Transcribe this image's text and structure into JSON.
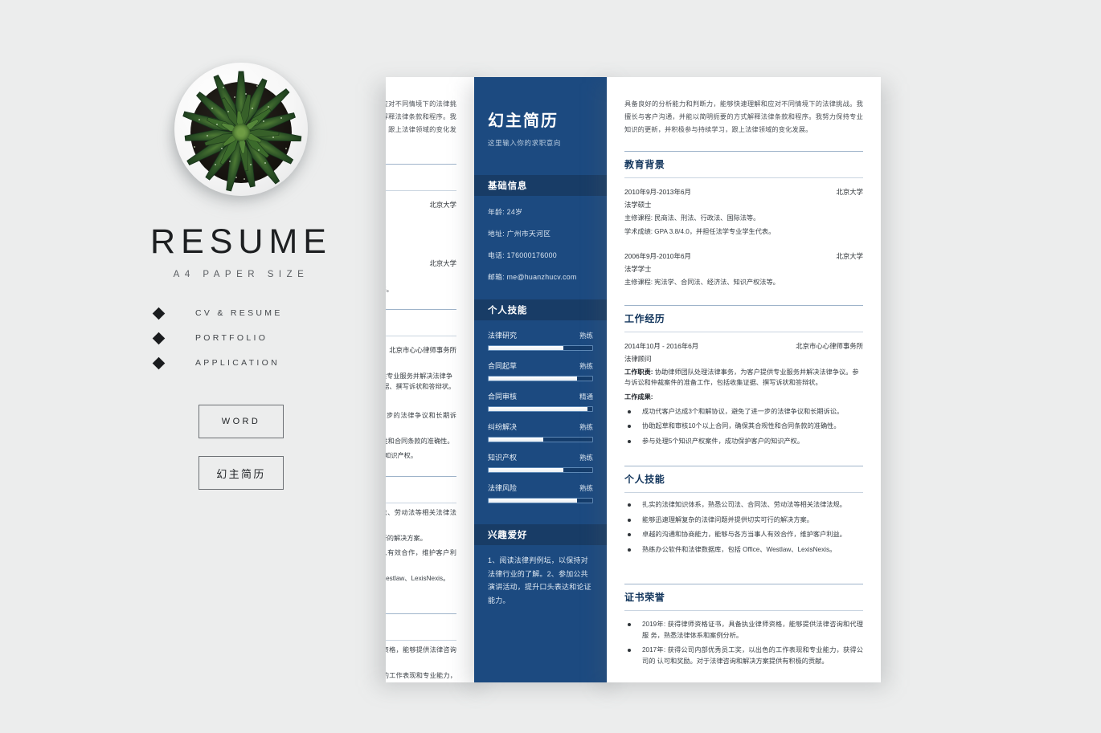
{
  "brand": {
    "title": "RESUME",
    "subtitle": "A4 PAPER SIZE",
    "bullets": [
      {
        "label": "CV & RESUME"
      },
      {
        "label": "PORTFOLIO"
      },
      {
        "label": "APPLICATION"
      }
    ],
    "buttons": [
      {
        "label": "WORD"
      },
      {
        "label": "幻主简历"
      }
    ],
    "plant_alt": "succulent-plant-top-view"
  },
  "sidebar": {
    "name": "幻主简历",
    "objective": "这里输入你的求职意向",
    "basic_info": {
      "heading": "基础信息",
      "rows": [
        "年龄: 24岁",
        "地址: 广州市天河区",
        "电话: 176000176000",
        "邮箱: me@huanzhucv.com"
      ]
    },
    "skills": {
      "heading": "个人技能",
      "items": [
        {
          "name": "法律研究",
          "level": "熟练",
          "percent": 72
        },
        {
          "name": "合同起草",
          "level": "熟练",
          "percent": 85
        },
        {
          "name": "合同审核",
          "level": "精通",
          "percent": 95
        },
        {
          "name": "纠纷解决",
          "level": "熟练",
          "percent": 53
        },
        {
          "name": "知识产权",
          "level": "熟练",
          "percent": 72
        },
        {
          "name": "法律风险",
          "level": "熟练",
          "percent": 85
        }
      ]
    },
    "hobbies": {
      "heading": "兴趣爱好",
      "text": "1、阅读法律判例坛，以保持对法律行业的了解。2、参加公共演讲活动，提升口头表达和论证能力。"
    },
    "colors": {
      "panel": "#1c4a80",
      "band": "#183c66"
    }
  },
  "page": {
    "intro": "具备良好的分析能力和判断力，能够快速理解和应对不同情境下的法律挑战。我擅长与客户沟通，并能以简明扼要的方式解释法律条款和程序。我努力保持专业知识的更新，并积极参与持续学习，跟上法律领域的变化发展。",
    "education": {
      "heading": "教育背景",
      "entries": [
        {
          "date": "2010年9月-2013年6月",
          "org": "北京大学",
          "role": "法学硕士",
          "lines": [
            "主修课程: 民商法、刑法、行政法、国际法等。",
            "学术成绩: GPA 3.8/4.0，并担任法学专业学生代表。"
          ]
        },
        {
          "date": "2006年9月-2010年6月",
          "org": "北京大学",
          "role": "法学学士",
          "lines": [
            "主修课程: 宪法学、合同法、经济法、知识产权法等。"
          ]
        }
      ]
    },
    "work": {
      "heading": "工作经历",
      "entries": [
        {
          "date": "2014年10月 - 2016年6月",
          "org": "北京市心心律师事务所",
          "role": "法律顾问",
          "duty_label": "工作职责:",
          "duty_text": "协助律师团队处理法律事务，为客户提供专业服务并解决法律争议。参与诉讼和仲裁案件的准备工作，包括收集证据、撰写诉状和答辩状。",
          "result_label": "工作成果:",
          "results": [
            "成功代客户达成3个和解协议，避免了进一步的法律争议和长期诉讼。",
            "协助起草和审核10个以上合同，确保其合规性和合同条款的准确性。",
            "参与处理5个知识产权案件，成功保护客户的知识产权。"
          ]
        }
      ]
    },
    "skills": {
      "heading": "个人技能",
      "items": [
        "扎实的法律知识体系，熟悉公司法、合同法、劳动法等相关法律法规。",
        "能够迅速理解复杂的法律问题并提供切实可行的解决方案。",
        "卓越的沟通和协商能力，能够与各方当事人有效合作，维护客户利益。",
        "熟练办公软件和法律数据库，包括 Office、Westlaw、LexisNexis。"
      ]
    },
    "honors": {
      "heading": "证书荣誉",
      "items": [
        "2019年: 获得律师资格证书，具备执业律师资格，能够提供法律咨询和代理服 务，熟悉法律体系和案例分析。",
        "2017年: 获得公司内部优秀员工奖，以出色的工作表现和专业能力，获得公司的 认可和奖励。对于法律咨询和解决方案提供有积极的贡献。"
      ]
    },
    "colors": {
      "heading": "#12355c",
      "rule": "#9fb4ca"
    }
  }
}
